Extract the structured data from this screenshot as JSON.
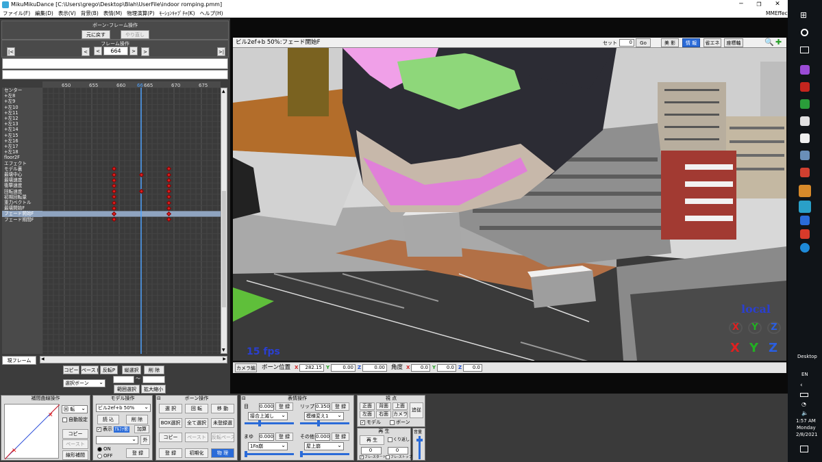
{
  "titlebar": {
    "text": "MikuMikuDance [C:\\Users\\grego\\Desktop\\Blah\\UserFile\\indoor romping.pmm]"
  },
  "menu": [
    "ファイル(F)",
    "編集(D)",
    "表示(V)",
    "背景(B)",
    "表情(M)",
    "物理演算(P)",
    "ﾓｰｼｮﾝｷｬﾌﾟﾁｬ(K)",
    "ヘルプ(H)"
  ],
  "mmeffect": "MMEffect",
  "bone_frame": {
    "title": "ボーン･フレーム操作",
    "undo": "元に戻す",
    "redo": "やり直し"
  },
  "frame_ops": {
    "title": "フレーム操作",
    "first": "|<",
    "prev_key": "<",
    "prev": "<",
    "value": "664",
    "next": ">",
    "next_key": ">",
    "last": ">|"
  },
  "timeline": {
    "ticks": [
      "650",
      "655",
      "660",
      "665",
      "670",
      "675"
    ],
    "current_frame_mark": "66",
    "tracks": [
      "センター",
      "左8",
      "左9",
      "左10",
      "左11",
      "左12",
      "左13",
      "左14",
      "左15",
      "左16",
      "左17",
      "左18",
      "floor2F",
      "エフェクト",
      "モデル裏",
      "最壊中心",
      "最壊速度",
      "衝撃速度",
      "回転速度",
      "初期回転量",
      "重力ベクトル",
      "最壊開始F",
      "フェード開始F",
      "フェード期間F"
    ],
    "keyframes": [
      {
        "track": 14,
        "frames": [
          659,
          669
        ]
      },
      {
        "track": 15,
        "frames": [
          659,
          664,
          669
        ]
      },
      {
        "track": 16,
        "frames": [
          659,
          669
        ]
      },
      {
        "track": 17,
        "frames": [
          659,
          669
        ]
      },
      {
        "track": 18,
        "frames": [
          659,
          664,
          669
        ]
      },
      {
        "track": 19,
        "frames": [
          659,
          669
        ]
      },
      {
        "track": 20,
        "frames": [
          659,
          669
        ]
      },
      {
        "track": 21,
        "frames": [
          659,
          669
        ]
      },
      {
        "track": 22,
        "frames": [
          659,
          669
        ]
      },
      {
        "track": 23,
        "frames": [
          659,
          669
        ]
      }
    ],
    "selected_track": 22,
    "current_frame": 664,
    "bottom_label": "現フレーム"
  },
  "edit_ops": {
    "copy": "コピー",
    "paste": "ペースト",
    "reverse": "反転P",
    "vsel": "縦選択",
    "delete": "削 除",
    "select_bone": "選択ボーン",
    "tilde": "～",
    "range": "範囲選択",
    "zoom": "拡大縮小"
  },
  "viewport": {
    "caption": "ビル2ef+b 50%:フェード開始F",
    "set_label": "セット",
    "set_value": "0",
    "go": "Go",
    "toggles": [
      "美 影",
      "情 報",
      "省エネ",
      "座標軸"
    ],
    "fps": "15 fps",
    "local": "local",
    "axes": [
      "X",
      "Y",
      "Z"
    ]
  },
  "position_bar": {
    "camera": "カメラ編",
    "bone_pos": "ボーン位置",
    "x_val": "282.15",
    "y_val": "0.00",
    "z_val": "0.00",
    "angle": "角度",
    "ax": "0.0",
    "ay": "0.0",
    "az": "0.0",
    "x": "X",
    "y": "Y",
    "z": "Z"
  },
  "curve": {
    "title": "補間曲線操作",
    "type": "回 転",
    "auto": "自動設定",
    "copy": "コピー",
    "paste": "ペースト",
    "linear": "線形補間"
  },
  "model_ops": {
    "title": "モデル操作",
    "model": "ビル2ef+b 50%",
    "load": "読 込",
    "delete": "削 除",
    "show": "表示",
    "alpha": "ｱﾙﾌｧ影",
    "add": "加算",
    "outside": "外",
    "on": "ON",
    "off": "OFF",
    "register": "登 録"
  },
  "bone_ops": {
    "title": "ボーン操作",
    "select": "選 択",
    "rotate": "回 転",
    "move": "移 動",
    "box": "BOX選択",
    "all": "全て選択",
    "unreg": "未登録選",
    "copy": "コピー",
    "paste": "ペースト",
    "rev": "反転ペースト",
    "reg": "登 録",
    "init": "初期化",
    "physics": "物 理"
  },
  "morph_ops": {
    "title": "表情操作",
    "eye": "目",
    "eye_val": "0.000",
    "eye_sel": "接合上滅し",
    "lip": "リップ",
    "lip_val": "0.350",
    "lip_sel": "模様変え1",
    "brow": "まゆ",
    "brow_val": "0.000",
    "brow_sel": "1Fa崩",
    "other": "その他",
    "other_val": "0.000",
    "other_sel": "屋上崩",
    "reg": "登 録"
  },
  "view_ops": {
    "title": "視 点",
    "front": "正面",
    "back": "背面",
    "top": "上面",
    "left": "左面",
    "right": "右面",
    "camera": "カメラ",
    "follow": "追従",
    "model": "モデル",
    "bone": "ボーン"
  },
  "play_ops": {
    "title": "再 生",
    "play": "再 生",
    "repeat": "くり返し",
    "from": "0",
    "to": "0",
    "frame_start": "フレ-スタート",
    "frame_stop": "フレ-ストップ",
    "volume": "音量"
  },
  "taskbar": {
    "desktop": "Desktop",
    "lang": "EN",
    "time": "1:57 AM",
    "day": "Monday",
    "date": "2/8/2021"
  },
  "colors": {
    "key": "#e02020",
    "timeline_bg": "#3a3a3a",
    "viewport_sky": "#d8d8d8",
    "accent": "#2a6bd8"
  }
}
